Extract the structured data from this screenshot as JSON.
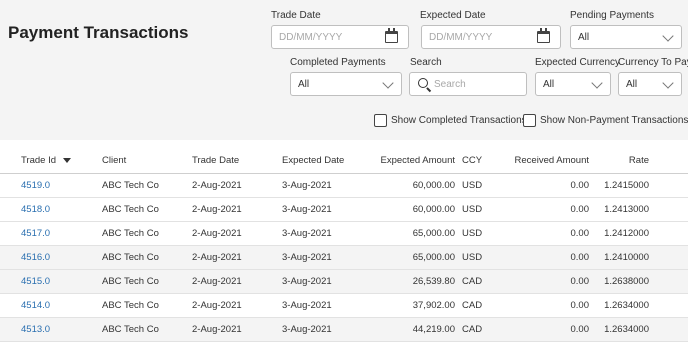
{
  "page": {
    "title": "Payment Transactions"
  },
  "filters": {
    "trade_date": {
      "label": "Trade Date",
      "placeholder": "DD/MM/YYYY"
    },
    "expected_date": {
      "label": "Expected Date",
      "placeholder": "DD/MM/YYYY"
    },
    "pending_payments": {
      "label": "Pending Payments",
      "value": "All"
    },
    "completed_payments": {
      "label": "Completed Payments",
      "value": "All"
    },
    "search": {
      "label": "Search",
      "placeholder": "Search"
    },
    "expected_currency": {
      "label": "Expected Currency",
      "value": "All"
    },
    "currency_to_pay": {
      "label": "Currency To Pay",
      "value": "All"
    },
    "show_completed": {
      "label": "Show Completed Transactions",
      "checked": false
    },
    "show_non_payment": {
      "label": "Show Non-Payment Transactions",
      "checked": false
    }
  },
  "table": {
    "columns": [
      "Trade Id",
      "Client",
      "Trade Date",
      "Expected Date",
      "Expected Amount",
      "CCY",
      "Received Amount",
      "Rate"
    ],
    "rows": [
      [
        "4519.0",
        "ABC Tech Co",
        "2-Aug-2021",
        "3-Aug-2021",
        "60,000.00",
        "USD",
        "0.00",
        "1.2415000"
      ],
      [
        "4518.0",
        "ABC Tech Co",
        "2-Aug-2021",
        "3-Aug-2021",
        "60,000.00",
        "USD",
        "0.00",
        "1.2413000"
      ],
      [
        "4517.0",
        "ABC Tech Co",
        "2-Aug-2021",
        "3-Aug-2021",
        "65,000.00",
        "USD",
        "0.00",
        "1.2412000"
      ],
      [
        "4516.0",
        "ABC Tech Co",
        "2-Aug-2021",
        "3-Aug-2021",
        "65,000.00",
        "USD",
        "0.00",
        "1.2410000"
      ],
      [
        "4515.0",
        "ABC Tech Co",
        "2-Aug-2021",
        "3-Aug-2021",
        "26,539.80",
        "CAD",
        "0.00",
        "1.2638000"
      ],
      [
        "4514.0",
        "ABC Tech Co",
        "2-Aug-2021",
        "3-Aug-2021",
        "37,902.00",
        "CAD",
        "0.00",
        "1.2634000"
      ],
      [
        "4513.0",
        "ABC Tech Co",
        "2-Aug-2021",
        "3-Aug-2021",
        "44,219.00",
        "CAD",
        "0.00",
        "1.2634000"
      ]
    ]
  },
  "colors": {
    "link": "#2a6fb0",
    "header_bg": "#f4f4f4",
    "alt_row": "#f4f4f4"
  }
}
